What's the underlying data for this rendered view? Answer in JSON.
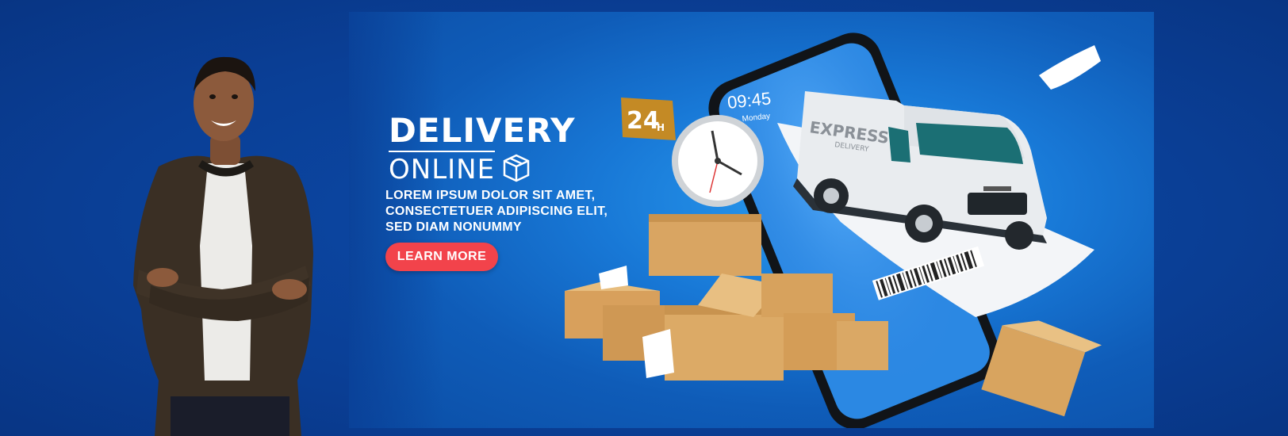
{
  "banner": {
    "title": "DELIVERY",
    "subtitle": "ONLINE",
    "tagline": [
      "LOREM IPSUM DOLOR SIT AMET,",
      "CONSECTETUER ADIPISCING ELIT,",
      "SED DIAM NONUMMY"
    ],
    "cta_label": "LEARN MORE",
    "phone_time": "09:45",
    "phone_day": "Monday",
    "hours_badge": "24",
    "hours_suffix": "H",
    "van_text_1": "EXPRESS",
    "van_text_2": "DELIVERY"
  },
  "icons": [
    "box-icon",
    "clock-icon",
    "barcode-icon"
  ],
  "colors": {
    "background": "#0a3f96",
    "banner_blue": "#1878d6",
    "cta": "#f2434b",
    "box": "#d9a562",
    "badge": "#c48a25"
  }
}
